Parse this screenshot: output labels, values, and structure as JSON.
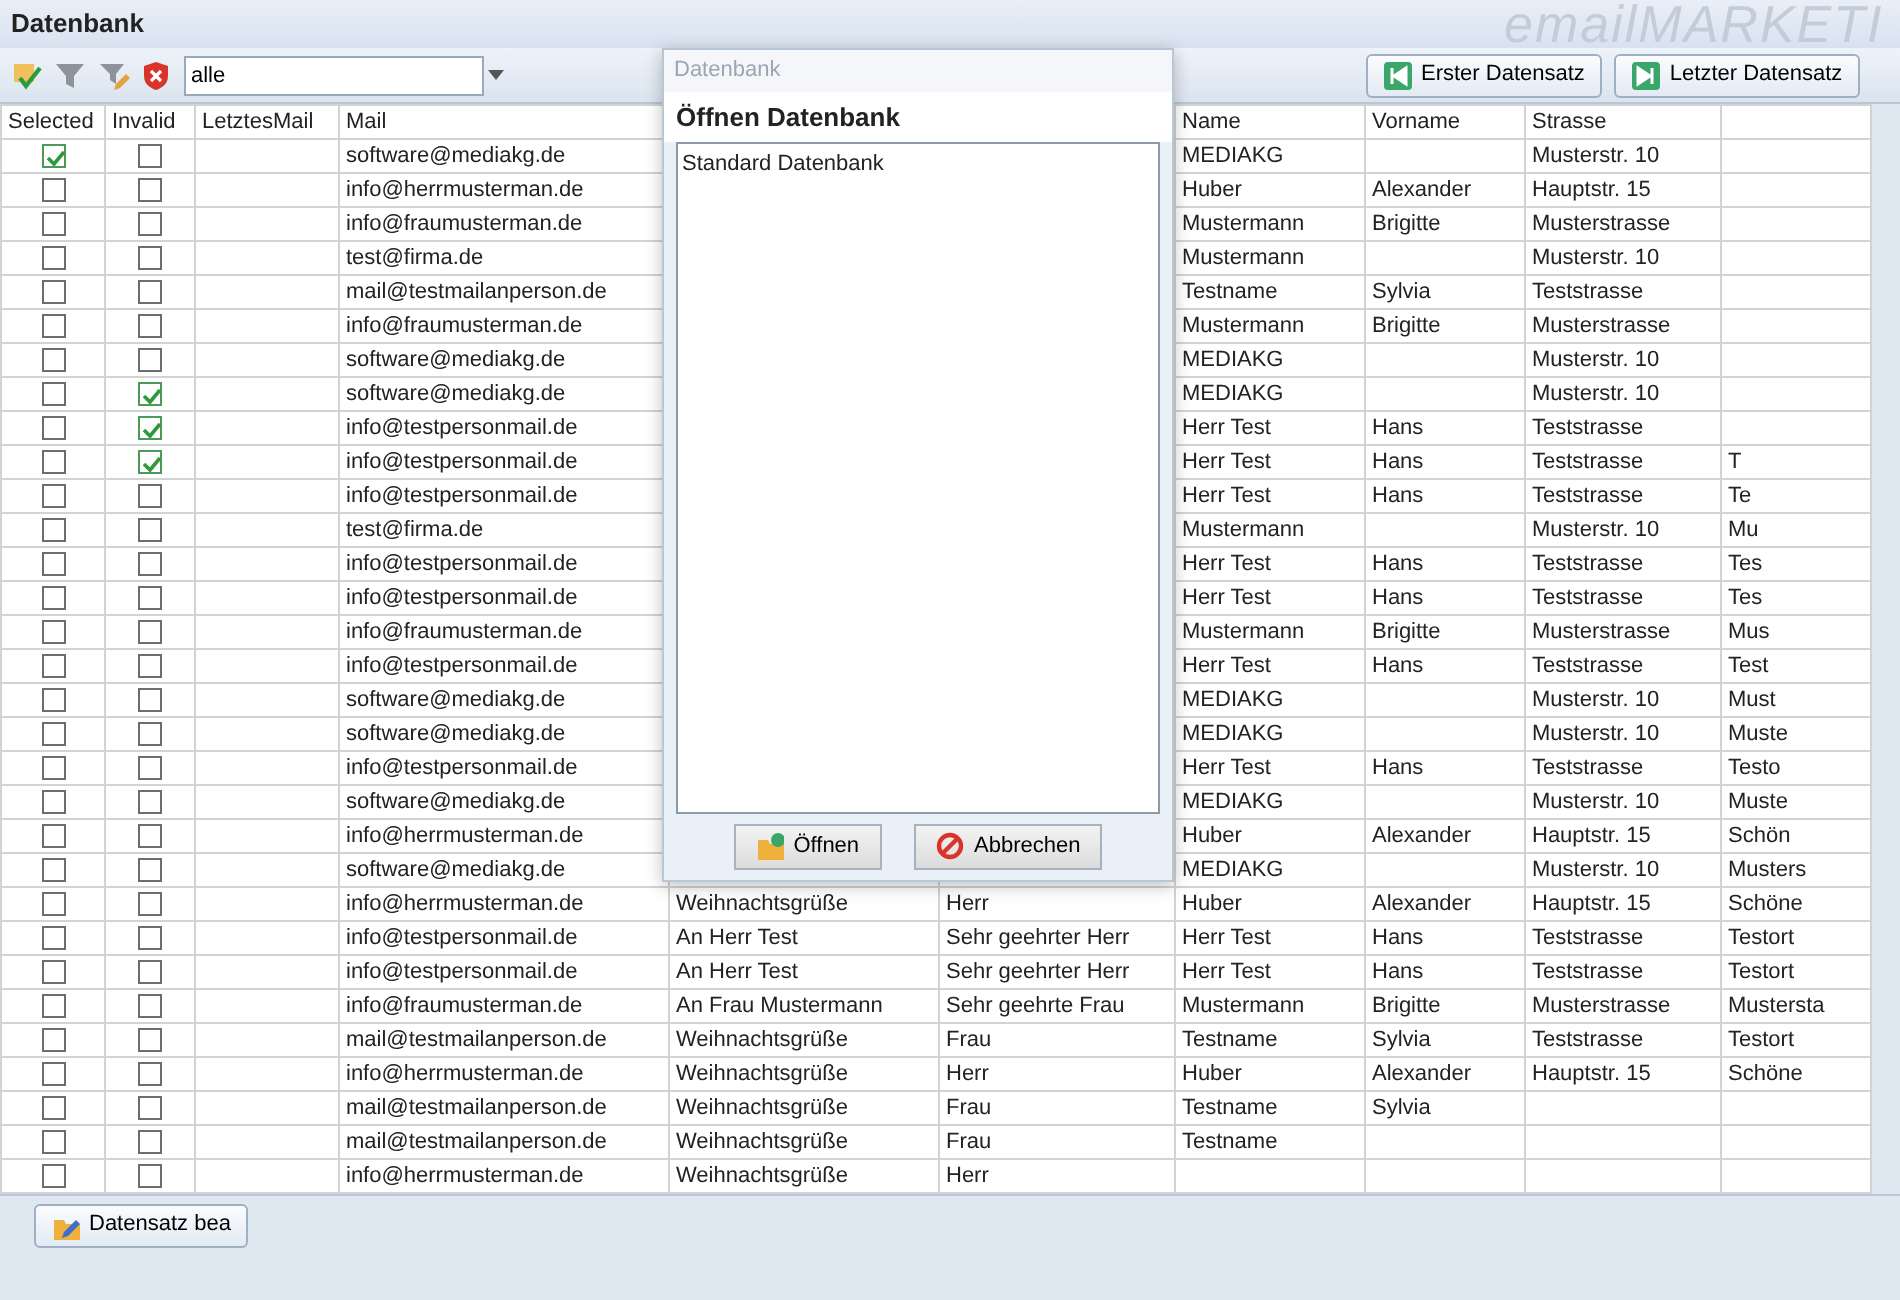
{
  "window": {
    "title": "Datenbank",
    "logo": "emailMARKETI"
  },
  "toolbar": {
    "filter": {
      "value": "alle"
    },
    "buttons": [
      {
        "label": "Erster Datensatz",
        "kind": "first"
      },
      {
        "label": "Letzter Datensatz",
        "kind": "last"
      }
    ]
  },
  "table": {
    "headers": {
      "selected": "Selected",
      "invalid": "Invalid",
      "letztes_mail": "LetztesMail",
      "mail": "Mail",
      "name": "Name",
      "vorname": "Vorname",
      "strasse": "Strasse"
    },
    "rows": [
      {
        "selected": true,
        "invalid": false,
        "mail": "software@mediakg.de",
        "name": "MEDIAKG",
        "strasse": "Musterstr. 10"
      },
      {
        "selected": false,
        "invalid": false,
        "mail": "info@herrmusterman.de",
        "name": "Huber",
        "vorname": "Alexander",
        "strasse": "Hauptstr. 15"
      },
      {
        "selected": false,
        "invalid": false,
        "mail": "info@fraumusterman.de",
        "name": "Mustermann",
        "vorname": "Brigitte",
        "strasse": "Musterstrasse"
      },
      {
        "selected": false,
        "invalid": false,
        "mail": "test@firma.de",
        "name": "Mustermann",
        "strasse": "Musterstr. 10"
      },
      {
        "selected": false,
        "invalid": false,
        "mail": "mail@testmailanperson.de",
        "name": "Testname",
        "vorname": "Sylvia",
        "strasse": "Teststrasse"
      },
      {
        "selected": false,
        "invalid": false,
        "mail": "info@fraumusterman.de",
        "name": "Mustermann",
        "vorname": "Brigitte",
        "strasse": "Musterstrasse"
      },
      {
        "selected": false,
        "invalid": false,
        "mail": "software@mediakg.de",
        "name": "MEDIAKG",
        "strasse": "Musterstr. 10"
      },
      {
        "selected": false,
        "invalid": true,
        "mail": "software@mediakg.de",
        "name": "MEDIAKG",
        "strasse": "Musterstr. 10"
      },
      {
        "selected": false,
        "invalid": true,
        "mail": "info@testpersonmail.de",
        "name": "Herr Test",
        "vorname": "Hans",
        "strasse": "Teststrasse"
      },
      {
        "selected": false,
        "invalid": true,
        "mail": "info@testpersonmail.de",
        "name": "Herr Test",
        "vorname": "Hans",
        "strasse": "Teststrasse",
        "column_10": "T"
      },
      {
        "selected": false,
        "invalid": false,
        "mail": "info@testpersonmail.de",
        "name": "Herr Test",
        "vorname": "Hans",
        "strasse": "Teststrasse",
        "column_10": "Te"
      },
      {
        "selected": false,
        "invalid": false,
        "mail": "test@firma.de",
        "name": "Mustermann",
        "strasse": "Musterstr. 10",
        "column_10": "Mu"
      },
      {
        "selected": false,
        "invalid": false,
        "mail": "info@testpersonmail.de",
        "name": "Herr Test",
        "vorname": "Hans",
        "strasse": "Teststrasse",
        "column_10": "Tes"
      },
      {
        "selected": false,
        "invalid": false,
        "mail": "info@testpersonmail.de",
        "name": "Herr Test",
        "vorname": "Hans",
        "strasse": "Teststrasse",
        "column_10": "Tes"
      },
      {
        "selected": false,
        "invalid": false,
        "mail": "info@fraumusterman.de",
        "name": "Mustermann",
        "vorname": "Brigitte",
        "strasse": "Musterstrasse",
        "column_10": "Mus"
      },
      {
        "selected": false,
        "invalid": false,
        "mail": "info@testpersonmail.de",
        "name": "Herr Test",
        "vorname": "Hans",
        "strasse": "Teststrasse",
        "column_10": "Test"
      },
      {
        "selected": false,
        "invalid": false,
        "mail": "software@mediakg.de",
        "name": "MEDIAKG",
        "strasse": "Musterstr. 10",
        "column_10": "Must"
      },
      {
        "selected": false,
        "invalid": false,
        "mail": "software@mediakg.de",
        "name": "MEDIAKG",
        "strasse": "Musterstr. 10",
        "column_10": "Muste"
      },
      {
        "selected": false,
        "invalid": false,
        "mail": "info@testpersonmail.de",
        "name": "Herr Test",
        "vorname": "Hans",
        "strasse": "Teststrasse",
        "column_10": "Testo"
      },
      {
        "selected": false,
        "invalid": false,
        "mail": "software@mediakg.de",
        "name": "MEDIAKG",
        "strasse": "Musterstr. 10",
        "column_10": "Muste"
      },
      {
        "selected": false,
        "invalid": false,
        "mail": "info@herrmusterman.de",
        "name": "Huber",
        "vorname": "Alexander",
        "strasse": "Hauptstr. 15",
        "column_10": "Schön"
      },
      {
        "selected": false,
        "invalid": false,
        "mail": "software@mediakg.de",
        "name": "MEDIAKG",
        "strasse": "Musterstr. 10",
        "column_10": "Musters"
      },
      {
        "selected": false,
        "invalid": false,
        "mail": "info@herrmusterman.de",
        "column_5": "Weihnachtsgrüße",
        "column_6": "Herr",
        "name": "Huber",
        "vorname": "Alexander",
        "strasse": "Hauptstr. 15",
        "column_10": "Schöne"
      },
      {
        "selected": false,
        "invalid": false,
        "mail": "info@testpersonmail.de",
        "column_5": "An Herr Test",
        "column_6": "Sehr geehrter Herr",
        "name": "Herr Test",
        "vorname": "Hans",
        "strasse": "Teststrasse",
        "column_10": "Testort"
      },
      {
        "selected": false,
        "invalid": false,
        "mail": "info@testpersonmail.de",
        "column_5": "An Herr Test",
        "column_6": "Sehr geehrter Herr",
        "name": "Herr Test",
        "vorname": "Hans",
        "strasse": "Teststrasse",
        "column_10": "Testort"
      },
      {
        "selected": false,
        "invalid": false,
        "mail": "info@fraumusterman.de",
        "column_5": "An Frau Mustermann",
        "column_6": "Sehr geehrte Frau",
        "name": "Mustermann",
        "vorname": "Brigitte",
        "strasse": "Musterstrasse",
        "column_10": "Mustersta"
      },
      {
        "selected": false,
        "invalid": false,
        "mail": "mail@testmailanperson.de",
        "column_5": "Weihnachtsgrüße",
        "column_6": "Frau",
        "name": "Testname",
        "vorname": "Sylvia",
        "strasse": "Teststrasse",
        "column_10": "Testort"
      },
      {
        "selected": false,
        "invalid": false,
        "mail": "info@herrmusterman.de",
        "column_5": "Weihnachtsgrüße",
        "column_6": "Herr",
        "name": "Huber",
        "vorname": "Alexander",
        "strasse": "Hauptstr. 15",
        "column_10": "Schöne"
      },
      {
        "selected": false,
        "invalid": false,
        "mail": "mail@testmailanperson.de",
        "column_5": "Weihnachtsgrüße",
        "column_6": "Frau",
        "name": "Testname",
        "vorname": "Sylvia"
      },
      {
        "selected": false,
        "invalid": false,
        "mail": "mail@testmailanperson.de",
        "column_5": "Weihnachtsgrüße",
        "column_6": "Frau",
        "name": "Testname"
      },
      {
        "selected": false,
        "invalid": false,
        "mail": "info@herrmusterman.de",
        "column_5": "Weihnachtsgrüße",
        "column_6": "Herr"
      }
    ]
  },
  "dialog": {
    "title": "Datenbank",
    "heading": "Öffnen Datenbank",
    "items": [
      {
        "label": "Standard Datenbank",
        "selected": false
      }
    ],
    "buttons": [
      {
        "label": "Öffnen",
        "kind": "open"
      },
      {
        "label": "Abbrechen",
        "kind": "cancel"
      }
    ]
  },
  "bottom_bar": {
    "buttons": [
      {
        "label": "Datensatz bea",
        "kind": "edit"
      }
    ]
  }
}
